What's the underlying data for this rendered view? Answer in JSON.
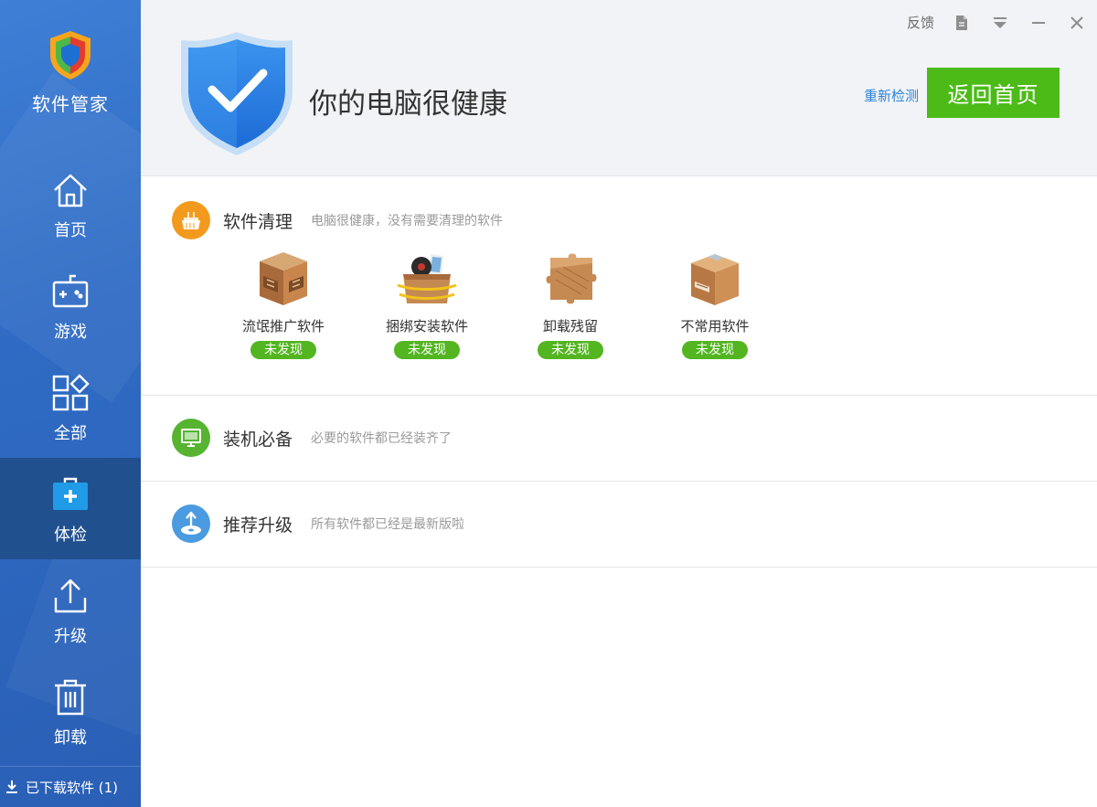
{
  "sidebar": {
    "brand_name": "软件管家",
    "items": [
      {
        "label": "首页",
        "icon": "home-icon"
      },
      {
        "label": "游戏",
        "icon": "gamepad-icon"
      },
      {
        "label": "全部",
        "icon": "grid-icon"
      },
      {
        "label": "体检",
        "icon": "medical-kit-icon",
        "active": true
      },
      {
        "label": "升级",
        "icon": "upload-icon"
      },
      {
        "label": "卸载",
        "icon": "trash-icon"
      }
    ],
    "downloads_label": "已下载软件 (1)"
  },
  "header": {
    "status_title": "你的电脑很健康",
    "feedback_label": "反馈",
    "recheck_label": "重新检测",
    "home_button_label": "返回首页"
  },
  "sections": {
    "cleanup": {
      "title": "软件清理",
      "desc": "电脑很健康，没有需要清理的软件",
      "items": [
        {
          "name": "流氓推广软件",
          "badge": "未发现",
          "icon": "rogue-box-icon"
        },
        {
          "name": "捆绑安装软件",
          "badge": "未发现",
          "icon": "bundled-box-icon"
        },
        {
          "name": "卸载残留",
          "badge": "未发现",
          "icon": "puzzle-piece-icon"
        },
        {
          "name": "不常用软件",
          "badge": "未发现",
          "icon": "sealed-box-icon"
        }
      ]
    },
    "essential": {
      "title": "装机必备",
      "desc": "必要的软件都已经装齐了"
    },
    "upgrade": {
      "title": "推荐升级",
      "desc": "所有软件都已经是最新版啦"
    }
  },
  "colors": {
    "sidebar_blue": "#2f6bc4",
    "sidebar_active": "#21508f",
    "primary_green": "#4cbb18",
    "badge_green": "#53b520",
    "link_blue": "#2d83d6",
    "cleanup_orange": "#f39a1e",
    "essential_green": "#56b431",
    "upgrade_blue": "#4a9be0"
  }
}
